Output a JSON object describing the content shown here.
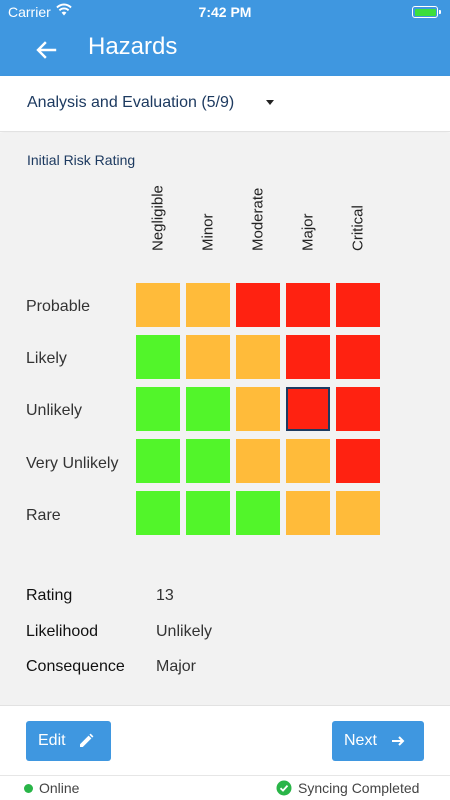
{
  "status_bar": {
    "carrier": "Carrier",
    "time": "7:42 PM",
    "wifi_icon": "wifi-icon",
    "battery_icon": "battery-icon"
  },
  "app_bar": {
    "title": "Hazards",
    "back_icon": "arrow-left-icon"
  },
  "section_selector": {
    "label": "Analysis and Evaluation (5/9)",
    "icon": "caret-down-icon"
  },
  "matrix": {
    "title": "Initial Risk Rating",
    "columns": [
      "Negligible",
      "Minor",
      "Moderate",
      "Major",
      "Critical"
    ],
    "rows": [
      {
        "label": "Probable",
        "cells": [
          "orange",
          "orange",
          "red",
          "red",
          "red"
        ]
      },
      {
        "label": "Likely",
        "cells": [
          "green",
          "orange",
          "orange",
          "red",
          "red"
        ]
      },
      {
        "label": "Unlikely",
        "cells": [
          "green",
          "green",
          "orange",
          "red",
          "red"
        ]
      },
      {
        "label": "Very Unlikely",
        "cells": [
          "green",
          "green",
          "orange",
          "orange",
          "red"
        ]
      },
      {
        "label": "Rare",
        "cells": [
          "green",
          "green",
          "green",
          "orange",
          "orange"
        ]
      }
    ],
    "selected": {
      "row": "Unlikely",
      "column": "Major"
    },
    "colors": {
      "green": "#52f52a",
      "orange": "#ffbb3a",
      "red": "#ff2211"
    }
  },
  "details": {
    "rating_label": "Rating",
    "rating_value": "13",
    "likelihood_label": "Likelihood",
    "likelihood_value": "Unlikely",
    "consequence_label": "Consequence",
    "consequence_value": "Major"
  },
  "footer": {
    "edit_label": "Edit",
    "edit_icon": "pencil-icon",
    "next_label": "Next",
    "next_icon": "arrow-right-icon"
  },
  "connection": {
    "status": "Online",
    "status_color": "#29b548",
    "sync_text": "Syncing Completed",
    "sync_icon": "check-circle-icon"
  },
  "accent_color": "#3f97e0"
}
